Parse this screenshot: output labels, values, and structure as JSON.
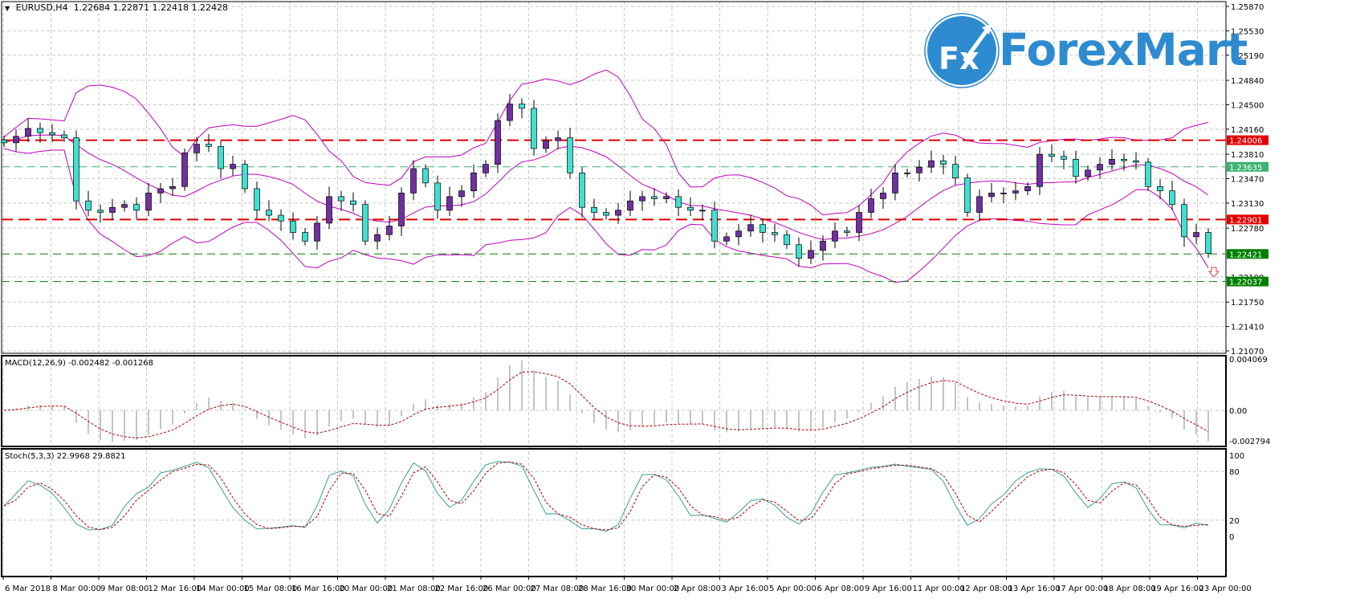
{
  "header": {
    "symbol": "EURUSD,H4",
    "ohlc": "1.22684 1.22871 1.22418 1.22428"
  },
  "logo": {
    "badge": "Fx",
    "name": "ForexMart"
  },
  "indicators": {
    "macd_label": "MACD(12,26,9) -0.002482 -0.001268",
    "stoch_label": "Stoch(5,3,3) 22.9968 29.8821"
  },
  "colors": {
    "bull": "#7030a0",
    "bear": "#40e0d0",
    "bands": "#c000c0",
    "red_level": "#e00000",
    "green_level": "#3cb371",
    "dark_green_level": "#008000",
    "stoch_main": "#3a9d9d",
    "signal": "#b00000",
    "logo": "#2e8bd0"
  },
  "chart_data": {
    "type": "candlestick",
    "symbol": "EURUSD",
    "timeframe": "H4",
    "ylim": [
      1.2107,
      1.2587
    ],
    "price_ticks": [
      "1.25870",
      "1.25530",
      "1.25190",
      "1.24840",
      "1.24500",
      "1.24160",
      "1.23810",
      "1.23470",
      "1.23130",
      "1.22780",
      "1.22100",
      "1.21750",
      "1.21410",
      "1.21070"
    ],
    "time_ticks": [
      "6 Mar 2018",
      "8 Mar 00:00",
      "9 Mar 08:00",
      "12 Mar 16:00",
      "14 Mar 00:00",
      "15 Mar 08:00",
      "16 Mar 16:00",
      "20 Mar 00:00",
      "21 Mar 08:00",
      "22 Mar 16:00",
      "26 Mar 00:00",
      "27 Mar 08:00",
      "28 Mar 16:00",
      "30 Mar 00:00",
      "2 Apr 08:00",
      "3 Apr 16:00",
      "5 Apr 00:00",
      "6 Apr 08:00",
      "9 Apr 16:00",
      "11 Apr 00:00",
      "12 Apr 08:00",
      "13 Apr 16:00",
      "17 Apr 00:00",
      "18 Apr 08:00",
      "19 Apr 16:00",
      "23 Apr 00:00"
    ],
    "close": [
      1.2397,
      1.2406,
      1.2417,
      1.2411,
      1.2408,
      1.2404,
      1.2316,
      1.2303,
      1.23,
      1.2307,
      1.2311,
      1.2303,
      1.2327,
      1.2333,
      1.2336,
      1.2383,
      1.2395,
      1.2392,
      1.2361,
      1.2367,
      1.2333,
      1.2303,
      1.2296,
      1.2288,
      1.2272,
      1.226,
      1.2285,
      1.2322,
      1.2316,
      1.2311,
      1.226,
      1.2269,
      1.2281,
      1.2327,
      1.2361,
      1.2341,
      1.2303,
      1.2322,
      1.233,
      1.2355,
      1.2367,
      1.2428,
      1.2451,
      1.2445,
      1.2389,
      1.24,
      1.2404,
      1.2355,
      1.2307,
      1.23,
      1.2296,
      1.2303,
      1.2316,
      1.2322,
      1.2319,
      1.2322,
      1.2307,
      1.2303,
      1.2303,
      1.226,
      1.2266,
      1.2274,
      1.2283,
      1.2272,
      1.2269,
      1.2255,
      1.2236,
      1.2247,
      1.226,
      1.2274,
      1.2272,
      1.23,
      1.2319,
      1.2327,
      1.2355,
      1.2355,
      1.2363,
      1.2372,
      1.2367,
      1.2348,
      1.23,
      1.2322,
      1.2327,
      1.2327,
      1.233,
      1.2336,
      1.2381,
      1.2378,
      1.2374,
      1.235,
      1.2359,
      1.2367,
      1.2374,
      1.2372,
      1.237,
      1.2336,
      1.233,
      1.2311,
      1.2266,
      1.2272,
      1.22428
    ],
    "levels": [
      {
        "price": "1.24006",
        "style": "red_level"
      },
      {
        "price": "1.23635",
        "style": "green_level"
      },
      {
        "price": "1.22901",
        "style": "red_level"
      },
      {
        "price": "1.22421",
        "style": "dark_green_level"
      },
      {
        "price": "1.22037",
        "style": "dark_green_level"
      }
    ],
    "macd": {
      "ticks": [
        "0.004069",
        "0.00",
        "-0.002794"
      ],
      "range": [
        -0.002794,
        0.004069
      ]
    },
    "stoch": {
      "ticks": [
        "100",
        "80",
        "20",
        "0"
      ]
    }
  }
}
